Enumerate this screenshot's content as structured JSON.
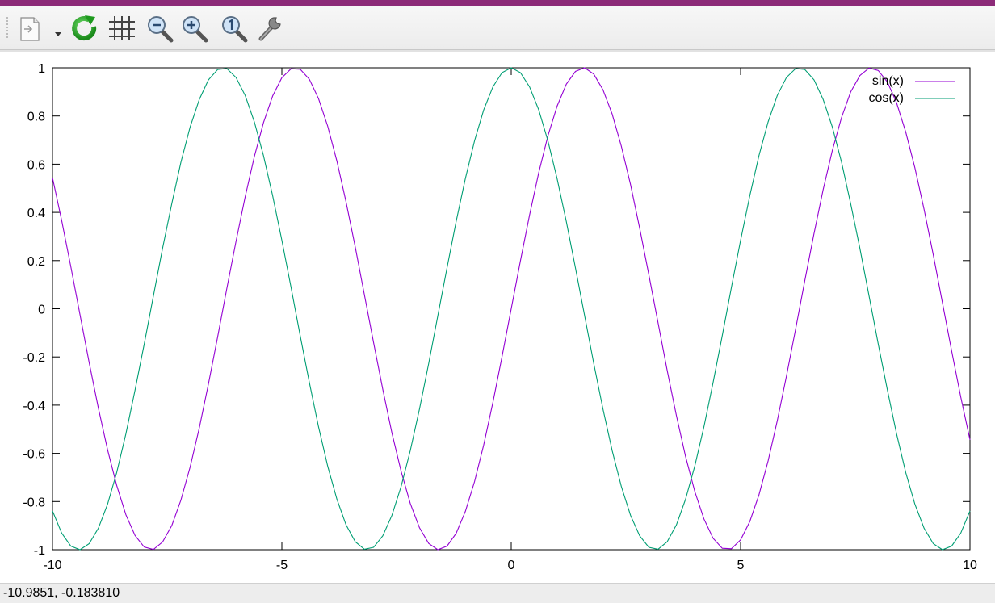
{
  "window": {
    "accent_color": "#8c2a78"
  },
  "toolbar": {
    "buttons": [
      {
        "name": "export-menu",
        "icon": "document-export-icon"
      },
      {
        "name": "replot",
        "icon": "refresh-icon"
      },
      {
        "name": "toggle-grid",
        "icon": "grid-icon"
      },
      {
        "name": "zoom-previous",
        "icon": "zoom-out-icon"
      },
      {
        "name": "zoom-next",
        "icon": "zoom-in-icon"
      },
      {
        "name": "unzoom",
        "icon": "zoom-reset-icon"
      },
      {
        "name": "configure",
        "icon": "wrench-icon"
      }
    ]
  },
  "status": {
    "coordinates": "-10.9851, -0.183810"
  },
  "chart_data": {
    "type": "line",
    "title": "",
    "xlabel": "",
    "ylabel": "",
    "xlim": [
      -10,
      10
    ],
    "ylim": [
      -1,
      1
    ],
    "x_ticks": [
      -10,
      -5,
      0,
      5,
      10
    ],
    "x_tick_labels": [
      "-10",
      "-5",
      "0",
      "5",
      "10"
    ],
    "y_ticks": [
      -1,
      -0.8,
      -0.6,
      -0.4,
      -0.2,
      0,
      0.2,
      0.4,
      0.6,
      0.8,
      1
    ],
    "y_tick_labels": [
      "-1",
      "-0.8",
      "-0.6",
      "-0.4",
      "-0.2",
      "0",
      "0.2",
      "0.4",
      "0.6",
      "0.8",
      "1"
    ],
    "grid": false,
    "legend_position": "top-right",
    "x": [
      -10,
      -9.8,
      -9.6,
      -9.4,
      -9.2,
      -9,
      -8.8,
      -8.6,
      -8.4,
      -8.2,
      -8,
      -7.8,
      -7.6,
      -7.4,
      -7.2,
      -7,
      -6.8,
      -6.6,
      -6.4,
      -6.2,
      -6,
      -5.8,
      -5.6,
      -5.4,
      -5.2,
      -5,
      -4.8,
      -4.6,
      -4.4,
      -4.2,
      -4,
      -3.8,
      -3.6,
      -3.4,
      -3.2,
      -3,
      -2.8,
      -2.6,
      -2.4,
      -2.2,
      -2,
      -1.8,
      -1.6,
      -1.4,
      -1.2,
      -1,
      -0.8,
      -0.6,
      -0.4,
      -0.2,
      0,
      0.2,
      0.4,
      0.6,
      0.8,
      1,
      1.2,
      1.4,
      1.6,
      1.8,
      2,
      2.2,
      2.4,
      2.6,
      2.8,
      3,
      3.2,
      3.4,
      3.6,
      3.8,
      4,
      4.2,
      4.4,
      4.6,
      4.8,
      5,
      5.2,
      5.4,
      5.6,
      5.8,
      6,
      6.2,
      6.4,
      6.6,
      6.8,
      7,
      7.2,
      7.4,
      7.6,
      7.8,
      8,
      8.2,
      8.4,
      8.6,
      8.8,
      9,
      9.2,
      9.4,
      9.6,
      9.8,
      10
    ],
    "series": [
      {
        "name": "sin(x)",
        "color": "#9400d3",
        "values": [
          0.544,
          0.366,
          0.175,
          -0.025,
          -0.223,
          -0.412,
          -0.585,
          -0.733,
          -0.855,
          -0.941,
          -0.989,
          -0.999,
          -0.968,
          -0.9,
          -0.794,
          -0.657,
          -0.494,
          -0.312,
          -0.117,
          0.083,
          0.279,
          0.465,
          0.631,
          0.773,
          0.883,
          0.959,
          0.996,
          0.994,
          0.952,
          0.872,
          0.757,
          0.612,
          0.443,
          0.256,
          0.058,
          -0.141,
          -0.335,
          -0.516,
          -0.675,
          -0.808,
          -0.909,
          -0.974,
          -1.0,
          -0.985,
          -0.932,
          -0.841,
          -0.717,
          -0.565,
          -0.389,
          -0.199,
          0.0,
          0.199,
          0.389,
          0.565,
          0.717,
          0.841,
          0.932,
          0.985,
          1.0,
          0.974,
          0.909,
          0.808,
          0.675,
          0.516,
          0.335,
          0.141,
          -0.058,
          -0.256,
          -0.443,
          -0.612,
          -0.757,
          -0.872,
          -0.952,
          -0.994,
          -0.996,
          -0.959,
          -0.883,
          -0.773,
          -0.631,
          -0.465,
          -0.279,
          -0.083,
          0.117,
          0.312,
          0.494,
          0.657,
          0.794,
          0.9,
          0.968,
          0.999,
          0.989,
          0.941,
          0.855,
          0.733,
          0.585,
          0.412,
          0.223,
          0.025,
          -0.175,
          -0.366,
          -0.544
        ]
      },
      {
        "name": "cos(x)",
        "color": "#009e73",
        "values": [
          -0.839,
          -0.931,
          -0.985,
          -1.0,
          -0.975,
          -0.911,
          -0.811,
          -0.68,
          -0.519,
          -0.338,
          -0.146,
          0.054,
          0.251,
          0.436,
          0.608,
          0.754,
          0.869,
          0.95,
          0.993,
          0.997,
          0.96,
          0.885,
          0.776,
          0.635,
          0.469,
          0.284,
          0.088,
          -0.112,
          -0.307,
          -0.49,
          -0.654,
          -0.791,
          -0.897,
          -0.967,
          -0.998,
          -0.99,
          -0.942,
          -0.857,
          -0.737,
          -0.589,
          -0.416,
          -0.227,
          -0.029,
          0.17,
          0.362,
          0.54,
          0.697,
          0.825,
          0.921,
          0.98,
          1.0,
          0.98,
          0.921,
          0.825,
          0.697,
          0.54,
          0.362,
          0.17,
          -0.029,
          -0.227,
          -0.416,
          -0.589,
          -0.737,
          -0.857,
          -0.942,
          -0.99,
          -0.998,
          -0.967,
          -0.897,
          -0.791,
          -0.654,
          -0.49,
          -0.307,
          -0.112,
          0.088,
          0.284,
          0.469,
          0.635,
          0.776,
          0.885,
          0.96,
          0.997,
          0.993,
          0.95,
          0.869,
          0.754,
          0.608,
          0.436,
          0.251,
          0.054,
          -0.146,
          -0.338,
          -0.519,
          -0.68,
          -0.811,
          -0.911,
          -0.975,
          -1.0,
          -0.985,
          -0.931,
          -0.839
        ]
      }
    ]
  }
}
